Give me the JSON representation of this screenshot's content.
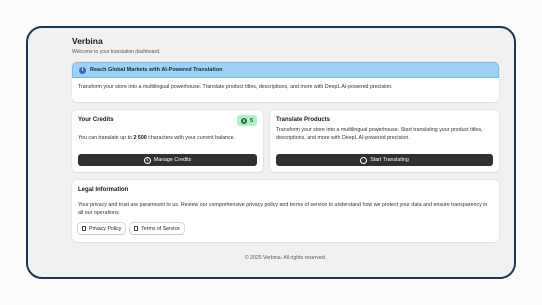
{
  "header": {
    "title": "Verbina",
    "subtitle": "Welcome to your translation dashboard."
  },
  "banner": {
    "title": "Reach Global Markets with AI-Powered Translation",
    "body": "Transform your store into a multilingual powerhouse. Translate product titles, descriptions, and more with DeepL AI-powered precision.",
    "icon": "info-icon",
    "color": "#9fd1f7"
  },
  "credits": {
    "title": "Your Credits",
    "badge_value": "5",
    "text_prefix": "You can translate up to ",
    "amount": "2 500",
    "text_suffix": " characters with your current balance.",
    "button_label": "Manage Credits"
  },
  "translate": {
    "title": "Translate Products",
    "body": "Transform your store into a multilingual powerhouse. Start translating your product titles, descriptions, and more with DeepL AI-powered precision.",
    "button_label": "Start Translating"
  },
  "legal": {
    "title": "Legal Information",
    "body": "Your privacy and trust are paramount to us. Review our comprehensive privacy policy and terms of service to understand how we protect your data and ensure transparency in all our operations.",
    "privacy_label": "Privacy Policy",
    "terms_label": "Terms of Service"
  },
  "footer": {
    "text": "© 2025 Verbina. All rights reserved."
  },
  "colors": {
    "frame_border": "#1f3556",
    "dark_button": "#303030",
    "badge": "#aef0c8"
  }
}
